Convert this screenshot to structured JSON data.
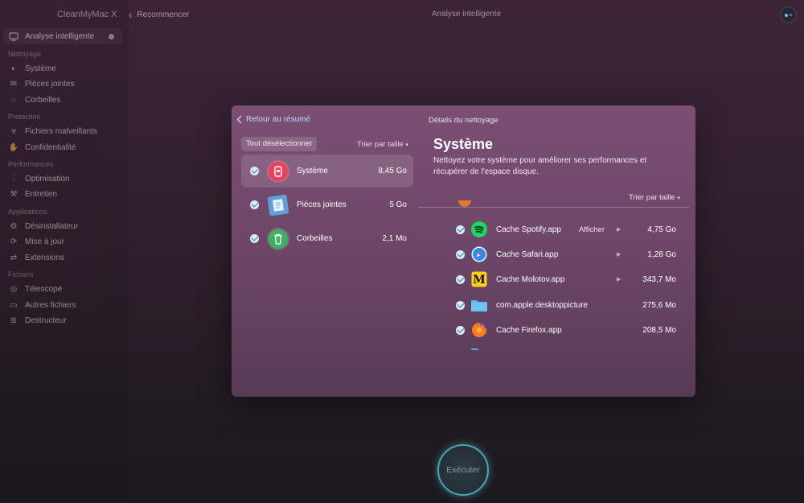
{
  "app": {
    "title": "CleanMyMac X"
  },
  "topbar": {
    "restart_label": "Recommencer",
    "title": "Analyse intelligente"
  },
  "sidebar": {
    "active": {
      "label": "Analyse intelligente"
    },
    "sections": [
      {
        "title": "Nettoyage",
        "items": [
          "Système",
          "Pièces jointes",
          "Corbeilles"
        ]
      },
      {
        "title": "Protection",
        "items": [
          "Fichiers malveillants",
          "Confidentialité"
        ]
      },
      {
        "title": "Performances",
        "items": [
          "Optimisation",
          "Entretien"
        ]
      },
      {
        "title": "Applications",
        "items": [
          "Désinstallateur",
          "Mise à jour",
          "Extensions"
        ]
      },
      {
        "title": "Fichiers",
        "items": [
          "Télescope",
          "Autres fichiers",
          "Destructeur"
        ]
      }
    ]
  },
  "panel": {
    "back_label": "Retour au résumé",
    "details_title": "Détails du nettoyage",
    "deselect_label": "Tout désélectionner",
    "sort_label": "Trier par taille",
    "categories": [
      {
        "name": "Système",
        "size": "8,45 Go"
      },
      {
        "name": "Pièces jointes",
        "size": "5 Go"
      },
      {
        "name": "Corbeilles",
        "size": "2,1 Mo"
      }
    ],
    "section_title": "Système",
    "description": "Nettoyez votre système pour améliorer ses performances et récupérer de l'espace disque.",
    "sort_right_label": "Trier par taille",
    "items": [
      {
        "name": "Cache Spotify.app",
        "show": "Afficher",
        "size": "4,75 Go",
        "icon": "spotify-icon"
      },
      {
        "name": "Cache Safari.app",
        "show": "",
        "size": "1,28 Go",
        "icon": "safari-icon"
      },
      {
        "name": "Cache Molotov.app",
        "show": "",
        "size": "343,7 Mo",
        "icon": "molotov-icon"
      },
      {
        "name": "com.apple.desktoppicture",
        "show": "",
        "size": "275,6 Mo",
        "icon": "folder-icon"
      },
      {
        "name": "Cache Firefox.app",
        "show": "",
        "size": "208,5 Mo",
        "icon": "firefox-icon"
      }
    ]
  },
  "execute_label": "Exécuter"
}
